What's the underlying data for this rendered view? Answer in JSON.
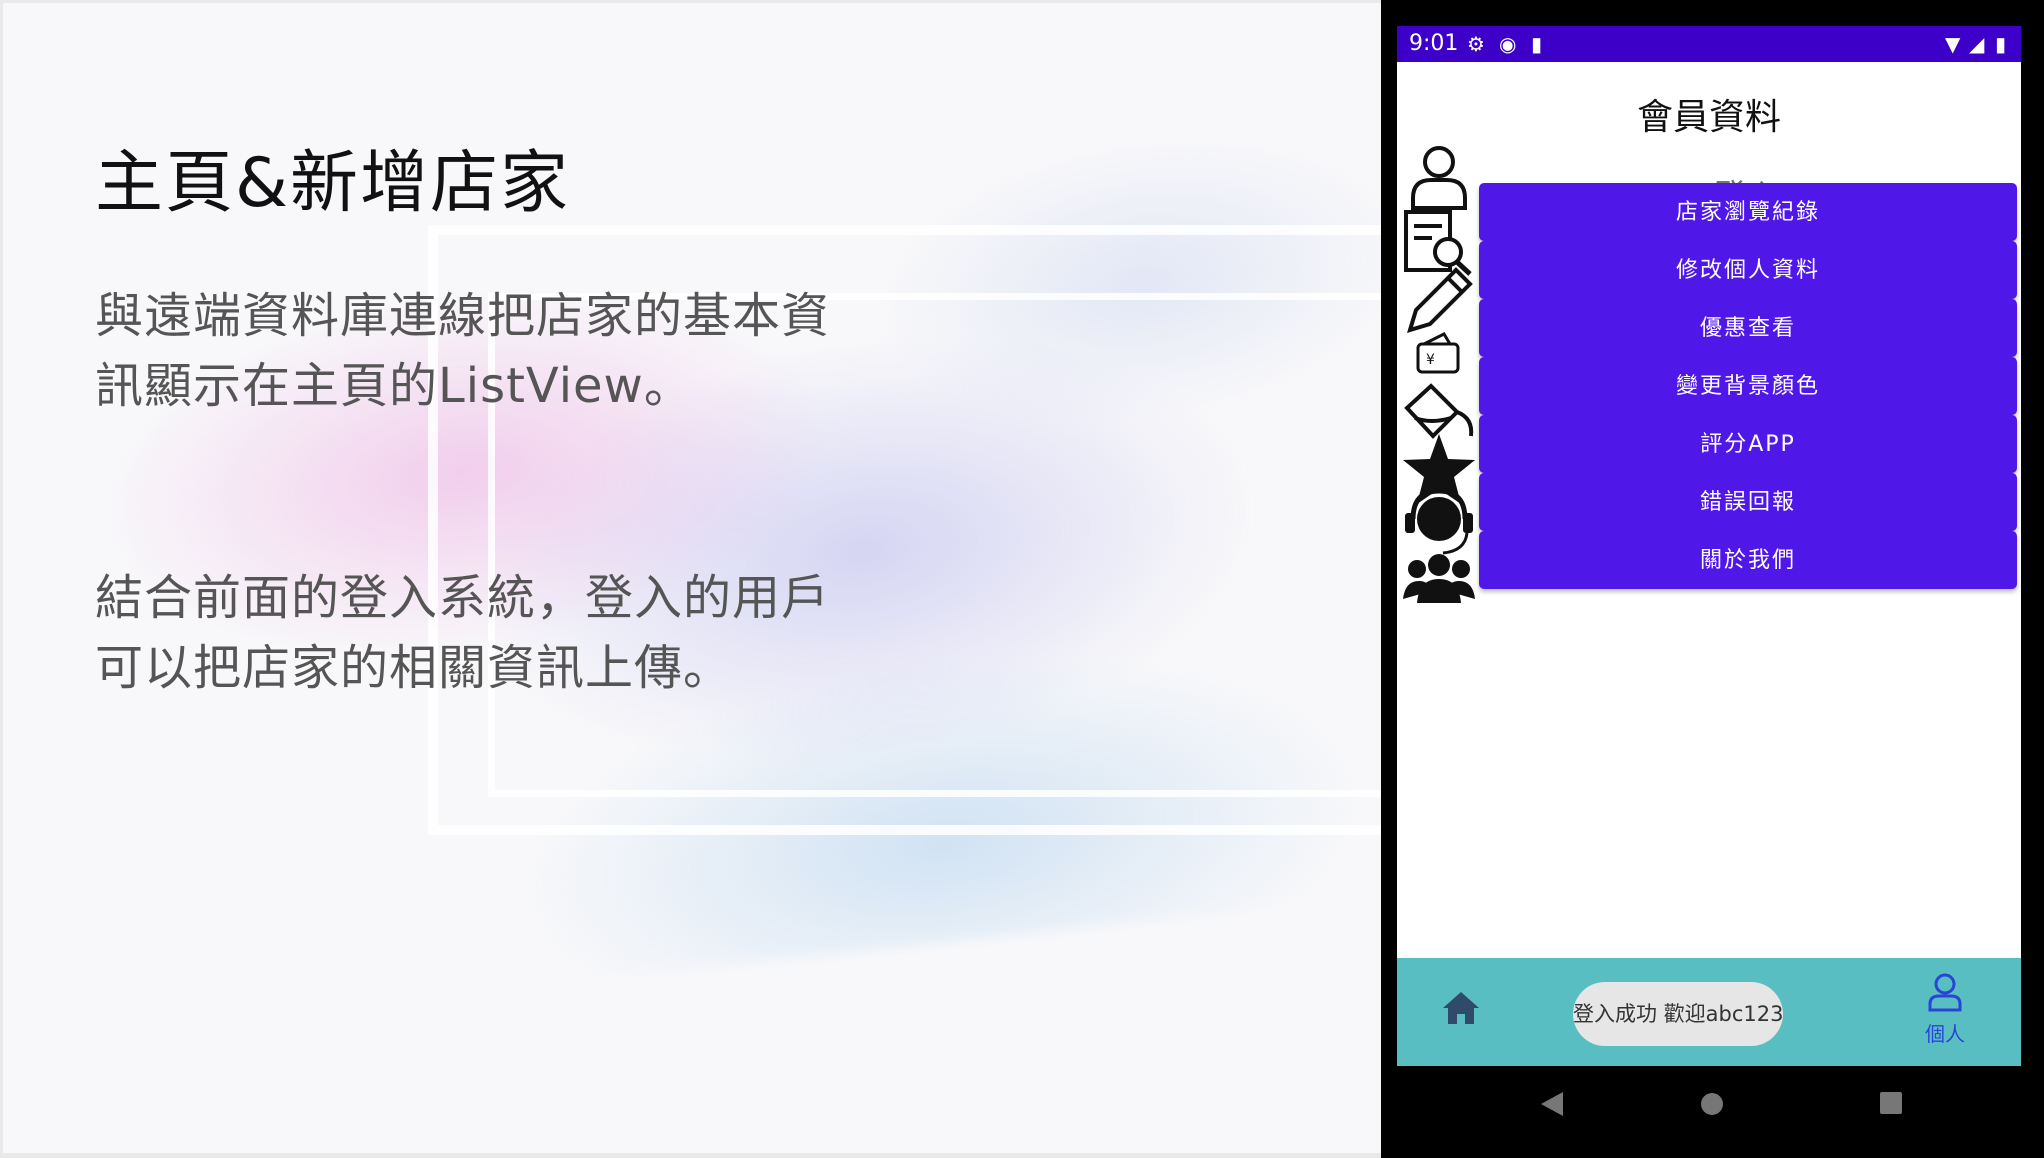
{
  "slide": {
    "title": "主頁&新增店家",
    "paragraph1": [
      "與遠端資料庫連線把店家的基本資",
      "訊顯示在主頁的ListView。"
    ],
    "paragraph2": [
      "結合前面的登入系統，登入的用戶",
      "可以把店家的相關資訊上傳。"
    ]
  },
  "phone": {
    "status_bar": {
      "time": "9:01",
      "color": "#3d00c8"
    },
    "app_title": "會員資料",
    "login_label": "登入",
    "menu": [
      {
        "label": "店家瀏覽紀錄",
        "icon": "document-search-icon"
      },
      {
        "label": "修改個人資料",
        "icon": "pencil-icon"
      },
      {
        "label": "優惠查看",
        "icon": "wallet-icon"
      },
      {
        "label": "變更背景顏色",
        "icon": "paint-bucket-icon"
      },
      {
        "label": "評分APP",
        "icon": "star-icon"
      },
      {
        "label": "錯誤回報",
        "icon": "headset-icon"
      },
      {
        "label": "關於我們",
        "icon": "group-icon"
      }
    ],
    "accent_color": "#5018e8",
    "bottom_nav": {
      "color": "#58bec2",
      "person_label": "個人",
      "toast": "登入成功 歡迎abc123"
    }
  }
}
